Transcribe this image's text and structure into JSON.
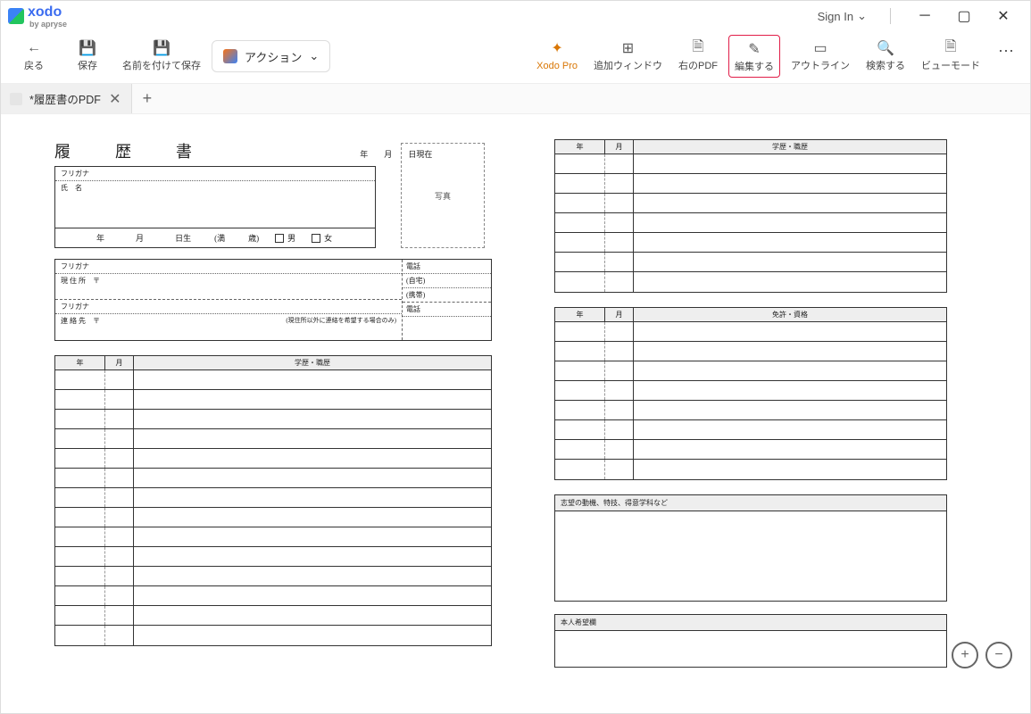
{
  "app": {
    "name": "xodo",
    "byline": "by apryse",
    "sign_in": "Sign In"
  },
  "toolbar": {
    "back": "戻る",
    "save": "保存",
    "save_as": "名前を付けて保存",
    "action": "アクション",
    "pro": "Xodo Pro",
    "add_window": "追加ウィンドウ",
    "right_pdf": "右のPDF",
    "edit": "編集する",
    "outline": "アウトライン",
    "search": "検索する",
    "view_mode": "ビューモード"
  },
  "tab": {
    "title": "*履歴書のPDF"
  },
  "resume": {
    "title": "履　歴　書",
    "date_suffix_year": "年",
    "date_suffix_month": "月",
    "date_suffix_day_now": "日現在",
    "furigana": "フリガナ",
    "name_label": "氏　名",
    "birth_year": "年",
    "birth_month": "月",
    "birth_day": "日生",
    "age_open": "(満",
    "age_close": "歳)",
    "male": "男",
    "female": "女",
    "photo": "写真",
    "address_label": "現 住 所",
    "postal": "〒",
    "phone": "電話",
    "phone_home": "(自宅)",
    "phone_mobile": "(携帯)",
    "contact": "連 絡 先",
    "contact_note": "(現住所以外に連絡を希望する場合のみ)",
    "col_year": "年",
    "col_month": "月",
    "col_history": "学歴・職歴",
    "col_license": "免許・資格",
    "motivation": "志望の動機、特技、得意学科など",
    "wishes": "本人希望欄"
  }
}
